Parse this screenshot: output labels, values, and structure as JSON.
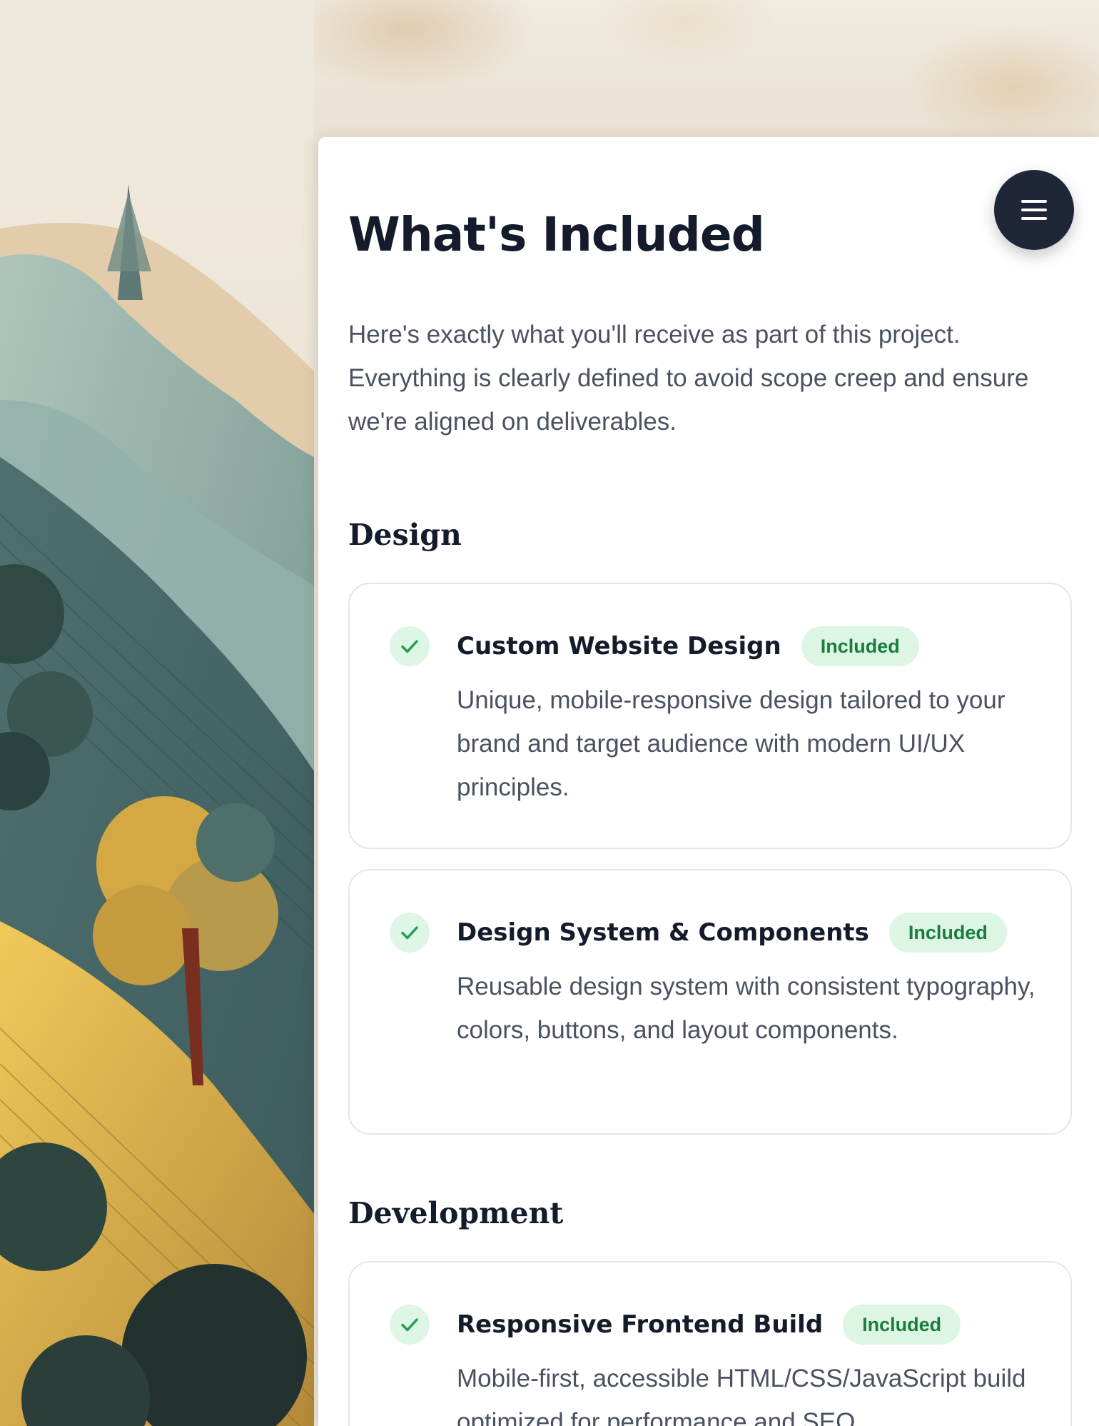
{
  "menu": {
    "icon": "hamburger-menu-icon"
  },
  "header": {
    "title": "What's Included",
    "intro": "Here's exactly what you'll receive as part of this project. Everything is clearly defined to avoid scope creep and ensure we're aligned on deliverables."
  },
  "sections": [
    {
      "heading": "Design",
      "items": [
        {
          "title": "Custom Website Design",
          "badge": "Included",
          "description": "Unique, mobile-responsive design tailored to your brand and target audience with modern UI/UX principles.",
          "icon": "checkmark-icon"
        },
        {
          "title": "Design System & Components",
          "badge": "Included",
          "description": "Reusable design system with consistent typography, colors, buttons, and layout components.",
          "icon": "checkmark-icon"
        }
      ]
    },
    {
      "heading": "Development",
      "items": [
        {
          "title": "Responsive Frontend Build",
          "badge": "Included",
          "description": "Mobile-first, accessible HTML/CSS/JavaScript build optimized for performance and SEO.",
          "icon": "checkmark-icon"
        }
      ]
    }
  ],
  "colors": {
    "heading": "#141b2b",
    "body_text": "#4a5262",
    "badge_bg": "#dcf6e3",
    "badge_text": "#1a7c3d",
    "check": "#22a04b",
    "menu_button": "#1f2637"
  }
}
